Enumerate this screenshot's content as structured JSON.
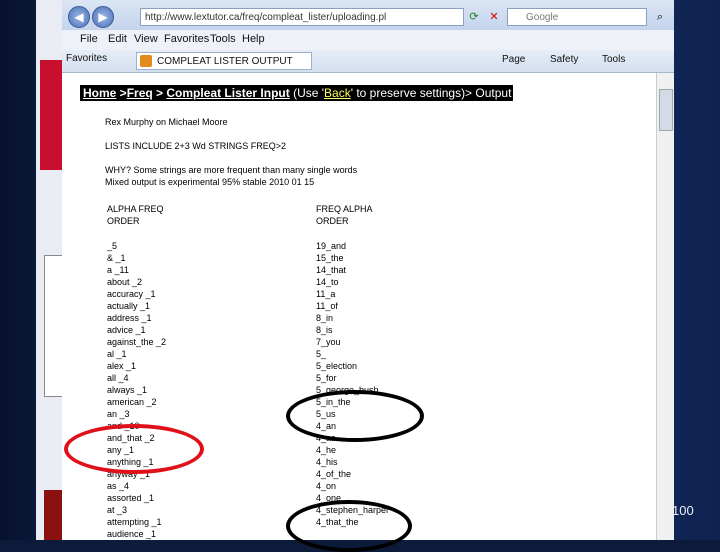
{
  "slide": {
    "page_number": "100"
  },
  "browser": {
    "url": "http://www.lextutor.ca/freq/compleat_lister/uploading.pl",
    "search_placeholder": "Google",
    "menu": [
      "File",
      "Edit",
      "View",
      "Favorites",
      "Tools",
      "Help"
    ],
    "favorites_label": "Favorites",
    "tab_title": "COMPLEAT LISTER OUTPUT",
    "commands": [
      "Page",
      "Safety",
      "Tools"
    ]
  },
  "page": {
    "nav": {
      "home": "Home",
      "freq": "Freq",
      "sep1": " >",
      "sep2": " > ",
      "input": "Compleat Lister Input",
      "use": " (Use '",
      "back": "Back",
      "rest": "' to preserve settings)> Output"
    },
    "line1": "Rex Murphy on Michael Moore",
    "line2": "LISTS INCLUDE 2+3 Wd STRINGS FREQ>2",
    "line3": "WHY? Some strings are more frequent than many single words",
    "line4": "Mixed output is experimental   95% stable 2010 01 15",
    "left_header": [
      "ALPHA FREQ",
      "ORDER"
    ],
    "right_header": [
      "FREQ ALPHA",
      "ORDER"
    ],
    "left_items": [
      "_5",
      "& _1",
      "a _11",
      "about _2",
      "accuracy _1",
      "actually _1",
      "address _1",
      "advice _1",
      "against_the _2",
      "al _1",
      "alex _1",
      "all _4",
      "always _1",
      "american _2",
      "an _3",
      "and _10",
      "and_that _2",
      "any _1",
      "anything _1",
      "anyway _1",
      "as _4",
      "assorted _1",
      "at _3",
      "attempting _1",
      "audience _1"
    ],
    "right_items": [
      "19_and",
      "15_the",
      "14_that",
      "14_to",
      "11_a",
      "11_of",
      "8_in",
      "8_is",
      "7_you",
      "5_",
      "5_election",
      "5_for",
      "5_george_bush",
      "5_in_the",
      "5_us",
      "4_an",
      "4_as",
      "4_he",
      "4_his",
      "4_of_the",
      "4_on",
      "4_one",
      "4_stephen_harper",
      "4_that_the"
    ]
  },
  "colors": {
    "highlight_red": "#e0101a",
    "highlight_black": "#000000"
  }
}
